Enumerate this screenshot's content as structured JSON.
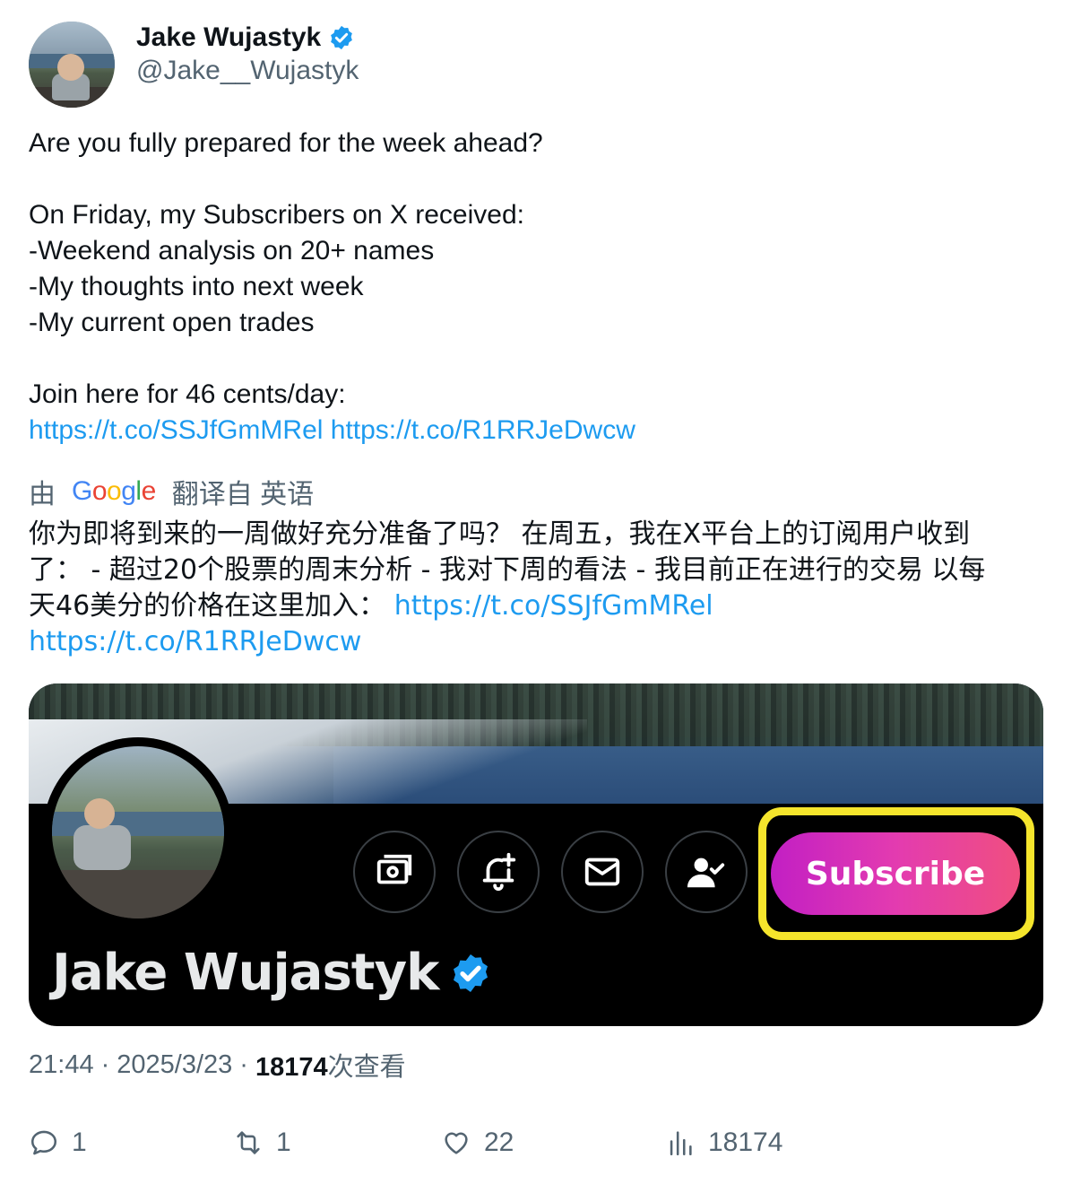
{
  "author": {
    "display_name": "Jake Wujastyk",
    "handle": "@Jake__Wujastyk",
    "verified": true
  },
  "tweet": {
    "lines": [
      "Are you fully prepared for the week ahead?",
      "",
      "On Friday, my Subscribers on X received:",
      "-Weekend analysis on 20+ names",
      "-My thoughts into next week",
      "-My current open trades",
      "",
      "Join here for 46 cents/day:"
    ],
    "link_1": "https://t.co/SSJfGmMRel",
    "link_2": "https://t.co/R1RRJeDwcw"
  },
  "translation": {
    "prefix": "由",
    "google_label": "Google",
    "suffix": "翻译自 英语",
    "line_1": "你为即将到来的一周做好充分准备了吗？ 在周五，我在X平台上的订阅用户收到",
    "line_2": "了： - 超过20个股票的周末分析 - 我对下周的看法 - 我目前正在进行的交易 以每",
    "line_3_text": "天46美分的价格在这里加入： ",
    "line_3_link": "https://t.co/SSJfGmMRel",
    "line_4_link": "https://t.co/R1RRJeDwcw"
  },
  "media": {
    "profile_name": "Jake Wujastyk",
    "subscribe_label": "Subscribe",
    "icons": [
      "money-icon",
      "bell-plus-icon",
      "mail-icon",
      "following-icon"
    ],
    "highlight_color": "#f5e52c"
  },
  "meta": {
    "time": "21:44",
    "separator": "·",
    "date": "2025/3/23",
    "views_count": "18174",
    "views_label": "次查看"
  },
  "actions": {
    "replies": "1",
    "reposts": "1",
    "likes": "22",
    "views": "18174"
  },
  "colors": {
    "link": "#1d9bf0",
    "verified": "#1d9bf0",
    "secondary_text": "#536471"
  }
}
